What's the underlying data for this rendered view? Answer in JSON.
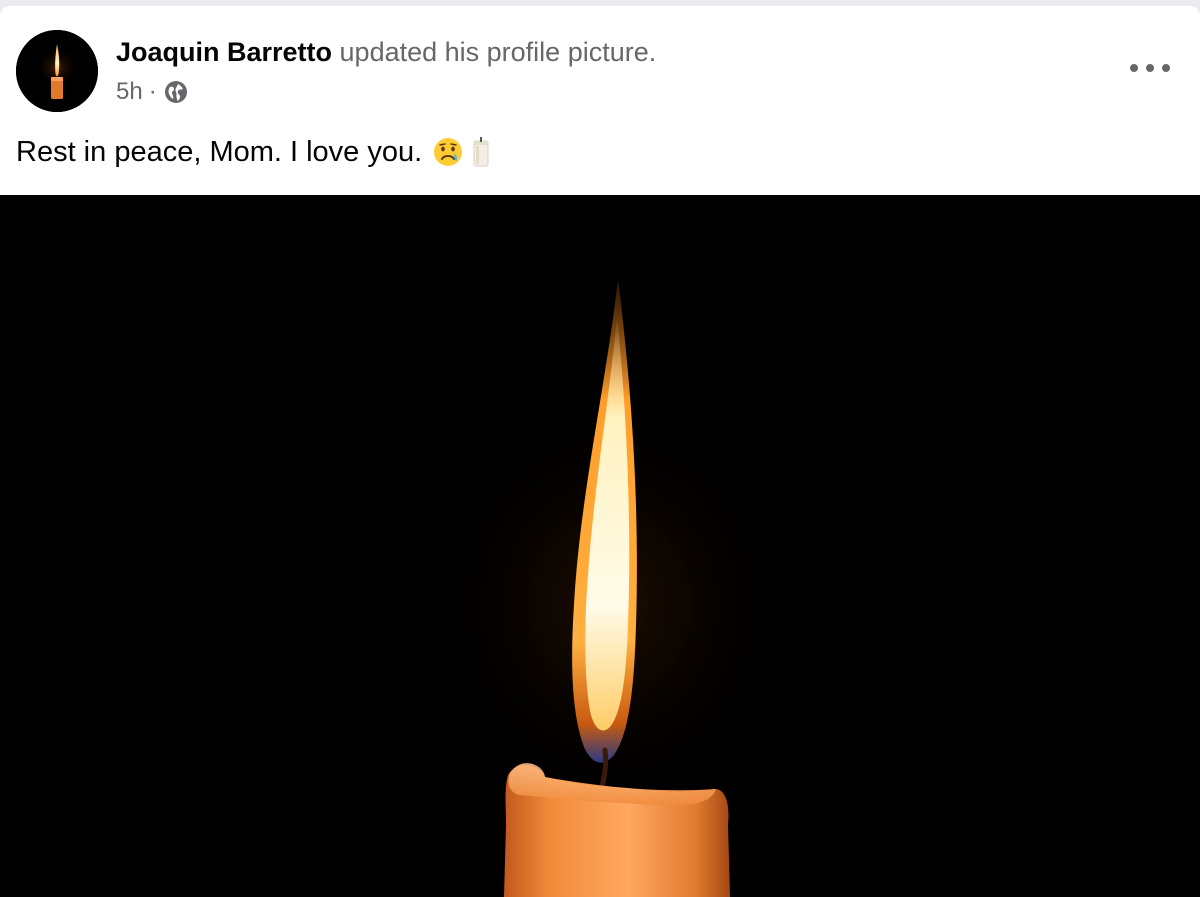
{
  "post": {
    "author": "Joaquin Barretto",
    "action": " updated his profile picture.",
    "timestamp": "5h",
    "separator": "·",
    "privacy_icon": "globe-icon",
    "menu_icon": "more-options-icon",
    "caption": "Rest in peace, Mom. I love you.",
    "caption_emojis": [
      "crying-face-emoji",
      "candle-emoji"
    ],
    "photo_subject": "candle-flame",
    "colors": {
      "author": "#050505",
      "secondary_text": "#65676b",
      "background": "#ffffff",
      "photo_background": "#000000"
    }
  }
}
